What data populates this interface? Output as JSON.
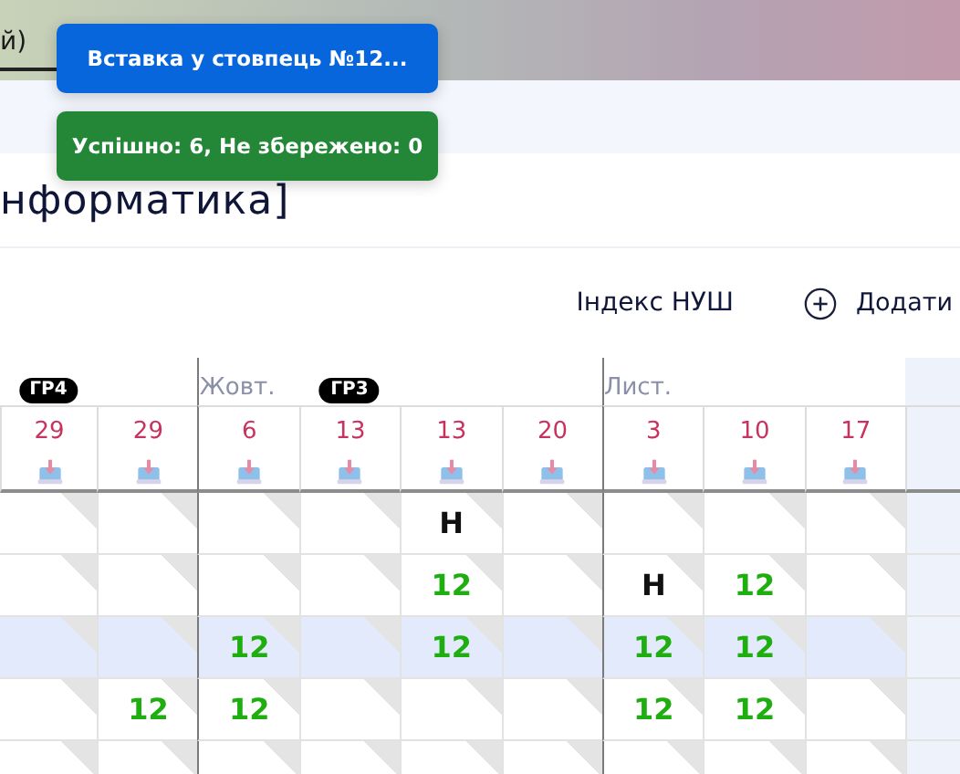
{
  "top_tab": {
    "label": "й)",
    "selected": true
  },
  "toasts": [
    {
      "kind": "info",
      "text": "Вставка у стовпець №12..."
    },
    {
      "kind": "success",
      "text": "Успішно: 6, Не збережено: 0"
    }
  ],
  "title": "нформатика]",
  "toolbar": {
    "index_label": "Індекс НУШ",
    "add_label": "Додати"
  },
  "columns": [
    {
      "date": "29",
      "badge": "ГР4",
      "selected": false
    },
    {
      "date": "29",
      "selected": false
    },
    {
      "date": "6",
      "month": "Жовт.",
      "selected": false
    },
    {
      "date": "13",
      "badge": "ГР3",
      "selected": false
    },
    {
      "date": "13",
      "selected": false
    },
    {
      "date": "20",
      "selected": false
    },
    {
      "date": "3",
      "month": "Лист.",
      "selected": false
    },
    {
      "date": "10",
      "selected": false
    },
    {
      "date": "17",
      "selected": false
    },
    {
      "selected": true
    }
  ],
  "rows": [
    {
      "selected": false,
      "cells": [
        {
          "kind": "empty"
        },
        {
          "kind": "empty"
        },
        {
          "kind": "empty"
        },
        {
          "kind": "empty"
        },
        {
          "kind": "absence",
          "text": "Н"
        },
        {
          "kind": "empty"
        },
        {
          "kind": "empty"
        },
        {
          "kind": "empty"
        },
        {
          "kind": "empty"
        },
        {
          "kind": "empty"
        }
      ]
    },
    {
      "selected": false,
      "cells": [
        {
          "kind": "empty"
        },
        {
          "kind": "empty"
        },
        {
          "kind": "empty"
        },
        {
          "kind": "empty"
        },
        {
          "kind": "grade",
          "text": "12"
        },
        {
          "kind": "empty"
        },
        {
          "kind": "absence",
          "text": "Н"
        },
        {
          "kind": "grade",
          "text": "12"
        },
        {
          "kind": "empty"
        },
        {
          "kind": "empty"
        }
      ]
    },
    {
      "selected": true,
      "cells": [
        {
          "kind": "empty"
        },
        {
          "kind": "empty"
        },
        {
          "kind": "grade",
          "text": "12"
        },
        {
          "kind": "empty"
        },
        {
          "kind": "grade",
          "text": "12"
        },
        {
          "kind": "empty"
        },
        {
          "kind": "grade",
          "text": "12"
        },
        {
          "kind": "grade",
          "text": "12"
        },
        {
          "kind": "empty"
        },
        {
          "kind": "empty"
        }
      ]
    },
    {
      "selected": false,
      "cells": [
        {
          "kind": "empty"
        },
        {
          "kind": "grade",
          "text": "12"
        },
        {
          "kind": "grade",
          "text": "12"
        },
        {
          "kind": "empty"
        },
        {
          "kind": "empty"
        },
        {
          "kind": "empty"
        },
        {
          "kind": "grade",
          "text": "12"
        },
        {
          "kind": "grade",
          "text": "12"
        },
        {
          "kind": "empty"
        },
        {
          "kind": "empty"
        }
      ]
    },
    {
      "selected": false,
      "cells": [
        {
          "kind": "empty"
        },
        {
          "kind": "empty"
        },
        {
          "kind": "empty"
        },
        {
          "kind": "empty"
        },
        {
          "kind": "empty"
        },
        {
          "kind": "empty"
        },
        {
          "kind": "empty"
        },
        {
          "kind": "empty"
        },
        {
          "kind": "empty"
        },
        {
          "kind": "empty"
        }
      ]
    }
  ]
}
